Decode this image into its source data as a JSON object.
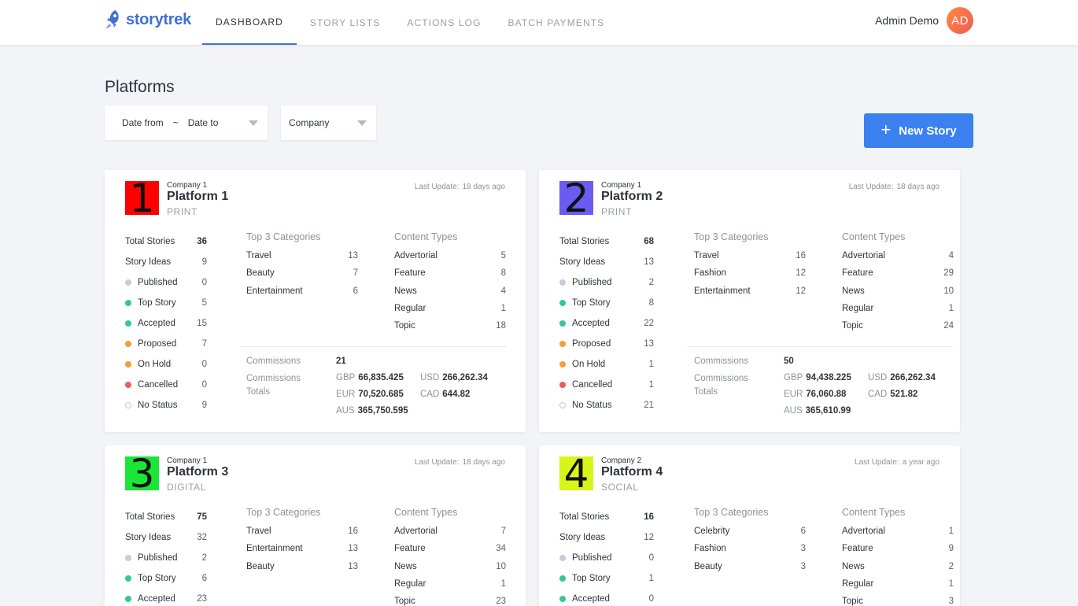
{
  "app": {
    "brand": "storytrek"
  },
  "nav": {
    "items": [
      {
        "label": "DASHBOARD",
        "active": true
      },
      {
        "label": "STORY LISTS",
        "active": false
      },
      {
        "label": "ACTIONS LOG",
        "active": false
      },
      {
        "label": "BATCH PAYMENTS",
        "active": false
      }
    ]
  },
  "user": {
    "name": "Admin Demo",
    "initials": "AD"
  },
  "page": {
    "title": "Platforms"
  },
  "filters": {
    "date_from": "Date from",
    "date_sep": "~",
    "date_to": "Date to",
    "company": "Company"
  },
  "new_story": {
    "label": "New Story"
  },
  "labels": {
    "total_stories": "Total Stories",
    "story_ideas": "Story Ideas",
    "top3": "Top 3 Categories",
    "content_types": "Content Types",
    "commissions": "Commissions",
    "commissions_totals_1": "Commissions",
    "commissions_totals_2": "Totals",
    "last_update": "Last Update:"
  },
  "colors": {
    "accent": "#3b82f0",
    "published": "#c9cbdc",
    "top_story": "#34c79a",
    "accepted": "#34c79a",
    "proposed": "#f0a03c",
    "on_hold": "#f0a03c",
    "cancelled": "#f05a5a",
    "no_status": "#ffffff"
  },
  "platforms": [
    {
      "badge_number": "1",
      "badge_color": "#ff0000",
      "company": "Company 1",
      "name": "Platform 1",
      "type": "PRINT",
      "last_update": "18 days ago",
      "total_stories": "36",
      "story_ideas": "9",
      "statuses": [
        {
          "label": "Published",
          "value": "0",
          "dot": "published"
        },
        {
          "label": "Top Story",
          "value": "5",
          "dot": "top_story"
        },
        {
          "label": "Accepted",
          "value": "15",
          "dot": "accepted"
        },
        {
          "label": "Proposed",
          "value": "7",
          "dot": "proposed"
        },
        {
          "label": "On Hold",
          "value": "0",
          "dot": "on_hold"
        },
        {
          "label": "Cancelled",
          "value": "0",
          "dot": "cancelled"
        },
        {
          "label": "No Status",
          "value": "9",
          "dot": "no_status"
        }
      ],
      "categories": [
        {
          "label": "Travel",
          "value": "13"
        },
        {
          "label": "Beauty",
          "value": "7"
        },
        {
          "label": "Entertainment",
          "value": "6"
        }
      ],
      "content_types": [
        {
          "label": "Advertorial",
          "value": "5"
        },
        {
          "label": "Feature",
          "value": "8"
        },
        {
          "label": "News",
          "value": "4"
        },
        {
          "label": "Regular",
          "value": "1"
        },
        {
          "label": "Topic",
          "value": "18"
        }
      ],
      "commissions": "21",
      "totals": {
        "GBP": "66,835.425",
        "USD": "266,262.34",
        "EUR": "70,520.685",
        "CAD": "644.82",
        "AUS": "365,750.595"
      }
    },
    {
      "badge_number": "2",
      "badge_color": "#6a5cf2",
      "company": "Company 1",
      "name": "Platform 2",
      "type": "PRINT",
      "last_update": "18 days ago",
      "total_stories": "68",
      "story_ideas": "13",
      "statuses": [
        {
          "label": "Published",
          "value": "2",
          "dot": "published"
        },
        {
          "label": "Top Story",
          "value": "8",
          "dot": "top_story"
        },
        {
          "label": "Accepted",
          "value": "22",
          "dot": "accepted"
        },
        {
          "label": "Proposed",
          "value": "13",
          "dot": "proposed"
        },
        {
          "label": "On Hold",
          "value": "1",
          "dot": "on_hold"
        },
        {
          "label": "Cancelled",
          "value": "1",
          "dot": "cancelled"
        },
        {
          "label": "No Status",
          "value": "21",
          "dot": "no_status"
        }
      ],
      "categories": [
        {
          "label": "Travel",
          "value": "16"
        },
        {
          "label": "Fashion",
          "value": "12"
        },
        {
          "label": "Entertainment",
          "value": "12"
        }
      ],
      "content_types": [
        {
          "label": "Advertorial",
          "value": "4"
        },
        {
          "label": "Feature",
          "value": "29"
        },
        {
          "label": "News",
          "value": "10"
        },
        {
          "label": "Regular",
          "value": "1"
        },
        {
          "label": "Topic",
          "value": "24"
        }
      ],
      "commissions": "50",
      "totals": {
        "GBP": "94,438.225",
        "USD": "266,262.34",
        "EUR": "76,060.88",
        "CAD": "521.82",
        "AUS": "365,610.99"
      }
    },
    {
      "badge_number": "3",
      "badge_color": "#19e635",
      "company": "Company 1",
      "name": "Platform 3",
      "type": "DIGITAL",
      "last_update": "18 days ago",
      "total_stories": "75",
      "story_ideas": "32",
      "statuses": [
        {
          "label": "Published",
          "value": "2",
          "dot": "published"
        },
        {
          "label": "Top Story",
          "value": "6",
          "dot": "top_story"
        },
        {
          "label": "Accepted",
          "value": "23",
          "dot": "accepted"
        }
      ],
      "categories": [
        {
          "label": "Travel",
          "value": "16"
        },
        {
          "label": "Entertainment",
          "value": "13"
        },
        {
          "label": "Beauty",
          "value": "13"
        }
      ],
      "content_types": [
        {
          "label": "Advertorial",
          "value": "7"
        },
        {
          "label": "Feature",
          "value": "34"
        },
        {
          "label": "News",
          "value": "10"
        },
        {
          "label": "Regular",
          "value": "1"
        },
        {
          "label": "Topic",
          "value": "23"
        }
      ]
    },
    {
      "badge_number": "4",
      "badge_color": "#d8f51a",
      "company": "Company 2",
      "name": "Platform 4",
      "type": "SOCIAL",
      "last_update": "a year ago",
      "total_stories": "16",
      "story_ideas": "12",
      "statuses": [
        {
          "label": "Published",
          "value": "0",
          "dot": "published"
        },
        {
          "label": "Top Story",
          "value": "1",
          "dot": "top_story"
        },
        {
          "label": "Accepted",
          "value": "0",
          "dot": "accepted"
        }
      ],
      "categories": [
        {
          "label": "Celebrity",
          "value": "6"
        },
        {
          "label": "Fashion",
          "value": "3"
        },
        {
          "label": "Beauty",
          "value": "3"
        }
      ],
      "content_types": [
        {
          "label": "Advertorial",
          "value": "1"
        },
        {
          "label": "Feature",
          "value": "9"
        },
        {
          "label": "News",
          "value": "2"
        },
        {
          "label": "Regular",
          "value": "1"
        },
        {
          "label": "Topic",
          "value": "3"
        }
      ]
    }
  ]
}
